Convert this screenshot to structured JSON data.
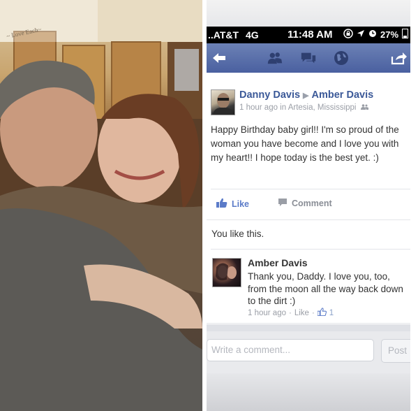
{
  "photo": {
    "sign_text": "~ Love Each~"
  },
  "status_bar": {
    "carrier": "..AT&T",
    "network": "4G",
    "time": "11:48 AM",
    "battery": "27%"
  },
  "nav_bar": {
    "icons": [
      "back-arrow-icon",
      "friends-icon",
      "messages-icon",
      "globe-icon",
      "share-icon"
    ]
  },
  "post": {
    "author": "Danny Davis",
    "recipient": "Amber Davis",
    "meta": "1 hour ago in Artesia, Mississippi",
    "text": "Happy Birthday baby girl!! I'm so proud of the woman you have become and I love you with my heart!! I hope today is the best yet. :)",
    "like_label": "Like",
    "comment_label": "Comment",
    "likes_text": "You like this."
  },
  "comment": {
    "author": "Amber Davis",
    "text": "Thank you, Daddy. I love you, too, from the moon all the way back down to the dirt :)",
    "time": "1 hour ago",
    "separator": "·",
    "like_label": "Like",
    "like_count": "1"
  },
  "composer": {
    "placeholder": "Write a comment...",
    "post_label": "Post"
  },
  "colors": {
    "navbar_top": "#6c81b5",
    "navbar_bottom": "#4a60a0",
    "link_blue": "#5b7bc8",
    "muted_gray": "#9a9ea6"
  }
}
